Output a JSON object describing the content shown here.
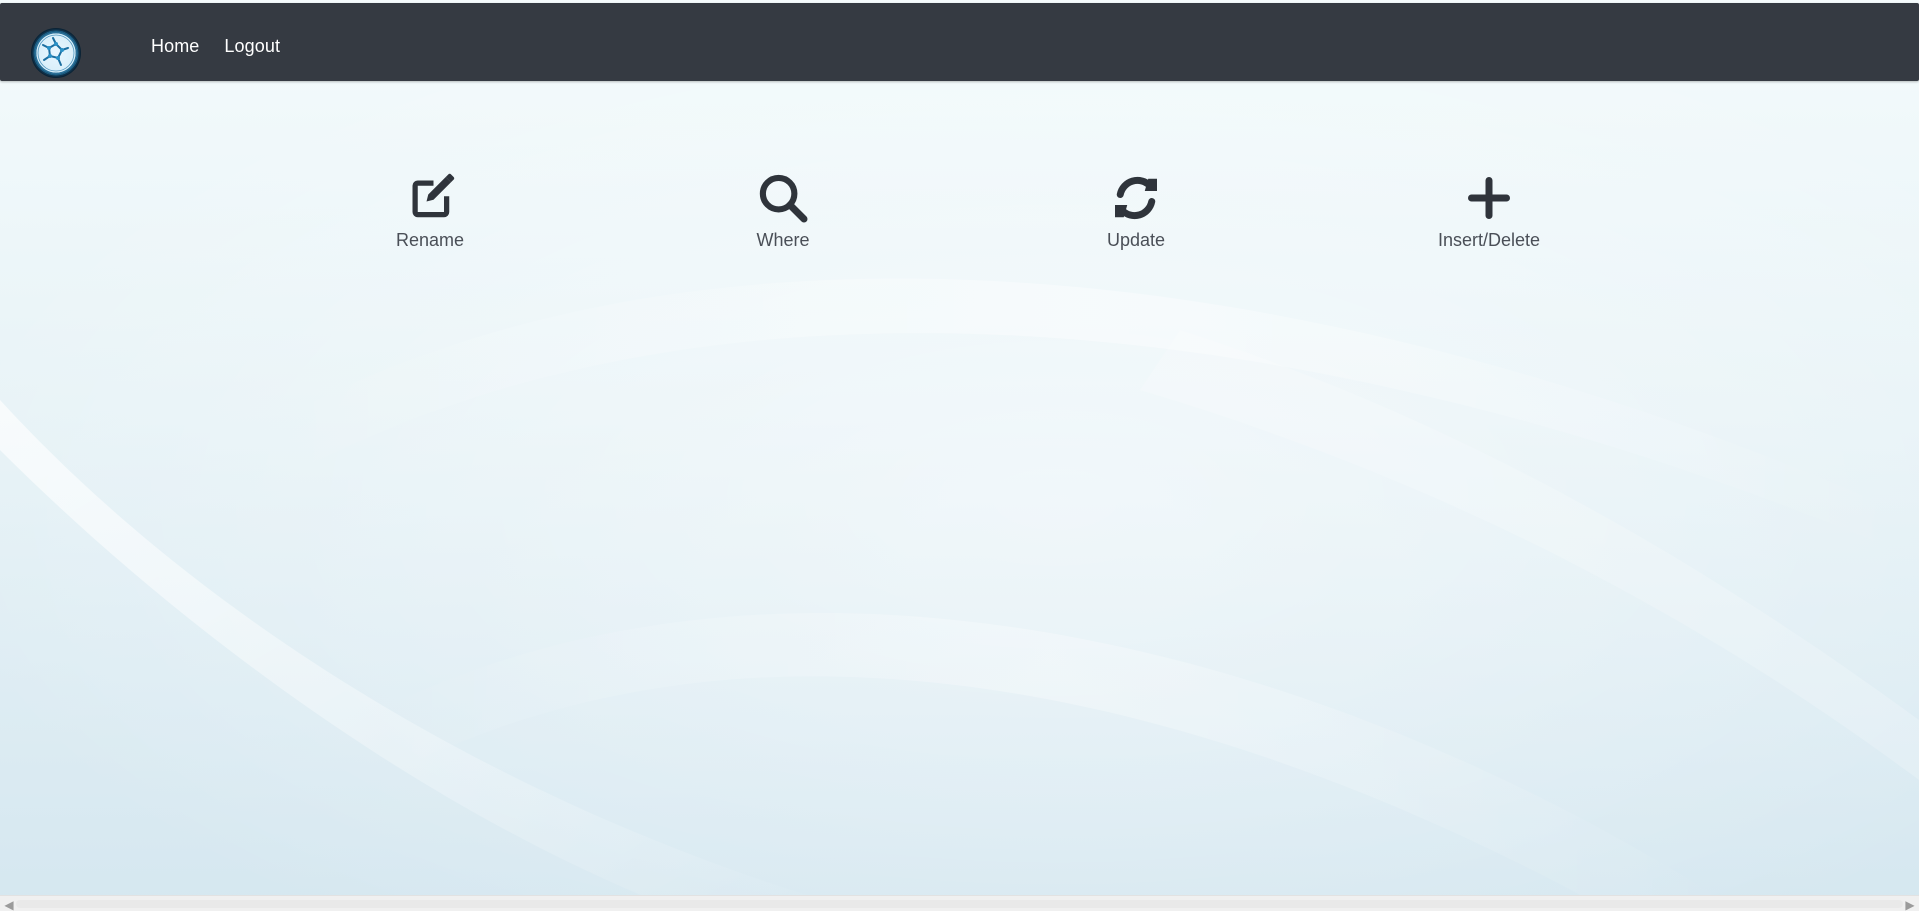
{
  "nav": {
    "items": [
      {
        "label": "Home"
      },
      {
        "label": "Logout"
      }
    ]
  },
  "actions": [
    {
      "label": "Rename",
      "icon": "edit-icon"
    },
    {
      "label": "Where",
      "icon": "search-icon"
    },
    {
      "label": "Update",
      "icon": "refresh-icon"
    },
    {
      "label": "Insert/Delete",
      "icon": "plus-icon"
    }
  ],
  "colors": {
    "topbar": "#353a42",
    "icon": "#2f343b",
    "label": "#4a4f57",
    "nav_text": "#ffffff"
  }
}
